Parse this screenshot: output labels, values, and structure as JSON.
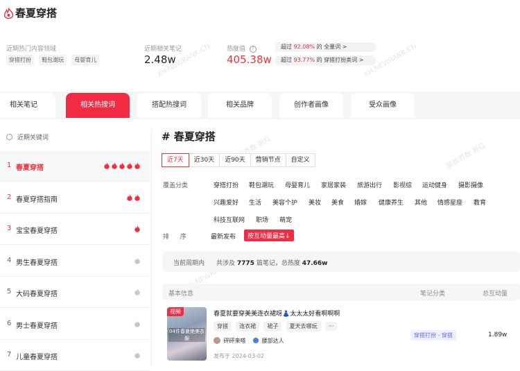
{
  "header": {
    "title": "春夏穿搭",
    "content_area_label": "近期热门内容领域",
    "content_area_tags": [
      "穿搭打扮",
      "鞋包潮玩",
      "母婴育儿"
    ],
    "notes_label": "近期相关笔记",
    "notes_value": "2.48w",
    "heat_label": "热度值",
    "heat_value": "405.38w",
    "pill1_pre": "超过",
    "pill1_pct": "92.08%",
    "pill1_post": "的 全量词",
    "pill2_pre": "超过",
    "pill2_pct": "93.77%",
    "pill2_post": "的 穿搭打扮类词",
    "chevron": ">"
  },
  "watermarks": [
    "XH.NEWRANK.CN",
    "新视界数·新红",
    "XH.NEWRANK.CN",
    "新视界数·新红",
    "XH.NEWRANK.CN"
  ],
  "tabs": [
    "相关笔记",
    "相关热搜词",
    "搭配热搜词",
    "相关品牌",
    "创作者画像",
    "受众画像"
  ],
  "sidebar": {
    "header": "近期关键词",
    "items": [
      {
        "rank": "1",
        "label": "春夏穿搭",
        "heat": 5
      },
      {
        "rank": "2",
        "label": "春夏穿搭指南",
        "heat": 2
      },
      {
        "rank": "3",
        "label": "宝宝春夏穿搭",
        "heat": 1
      },
      {
        "rank": "4",
        "label": "男生春夏穿搭",
        "heat": 0
      },
      {
        "rank": "5",
        "label": "大码春夏穿搭",
        "heat": 0
      },
      {
        "rank": "6",
        "label": "男士春夏穿搭",
        "heat": 0
      },
      {
        "rank": "7",
        "label": "儿童春夏穿搭",
        "heat": 0
      }
    ]
  },
  "main": {
    "title": "# 春夏穿搭",
    "periods": [
      "近7天",
      "近30天",
      "近90天",
      "营销节点",
      "自定义"
    ],
    "cover_label": "覆盖分类",
    "categories_row1": [
      "穿搭打扮",
      "鞋包潮玩",
      "母婴育儿",
      "家居家装",
      "旅游出行",
      "影视综",
      "运动健身",
      "摄影摄像"
    ],
    "categories_row2": [
      "兴趣爱好",
      "生活",
      "美容个护",
      "美妆",
      "美食",
      "婚嫁",
      "健康养生",
      "其他",
      "情感星座",
      "教育"
    ],
    "categories_row3": [
      "科技互联网",
      "职场",
      "萌宠"
    ],
    "sort_label_1": "排",
    "sort_label_2": "序",
    "sort_latest": "最新发布",
    "sort_interact": "按互动量最高",
    "summary": {
      "period_label": "当前周期内",
      "text1": "共涉及",
      "count": "7775",
      "text2": "篇笔记，总热度",
      "heat": "47.66w"
    },
    "table_headers": [
      "基本信息",
      "笔记分类",
      "总互动量"
    ],
    "note": {
      "badge": "视频",
      "thumb_caption": "04件春夏绝美衣服",
      "title": "春夏就要穿美美连衣裙呀👗太太太好看啊啊啊",
      "tags": [
        "穿搭",
        "连衣裙",
        "裙子",
        "夏天去哪玩",
        "···"
      ],
      "author": "砰砰来嗒",
      "author_level": "腰部达人",
      "date": "发布于 2024-03-02",
      "category": "穿搭打扮 - 穿搭",
      "interactions": "1.89w"
    }
  },
  "colors": {
    "accent": "#f02b43",
    "red_text": "#f0303d",
    "flame_gray": "#c8c8c8"
  }
}
